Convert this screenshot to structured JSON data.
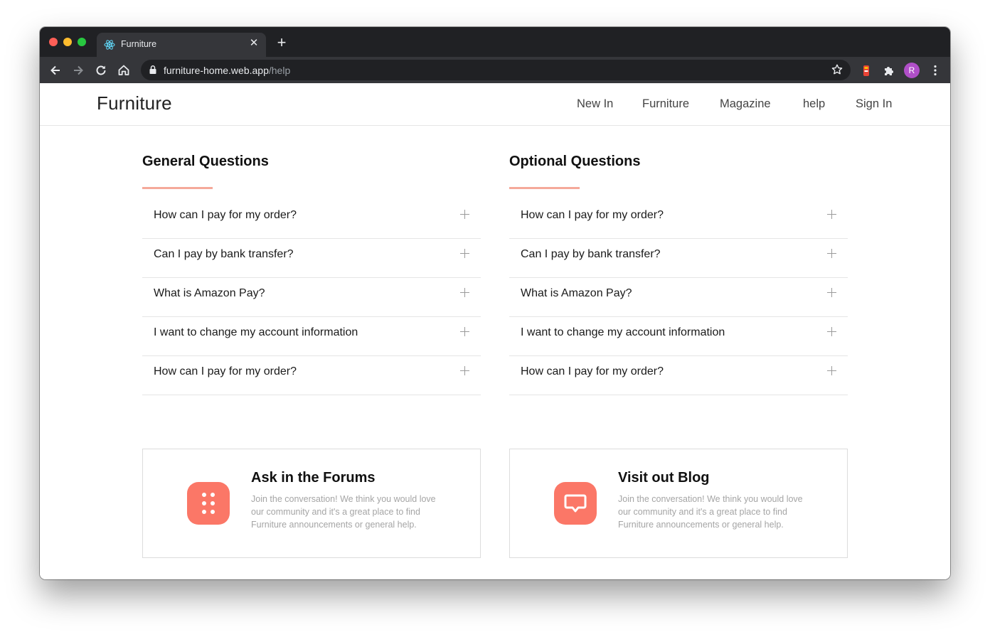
{
  "browser": {
    "tab_title": "Furniture",
    "url_host": "furniture-home.web.app",
    "url_path": "/help",
    "profile_initial": "R",
    "icons": [
      "back-icon",
      "forward-icon",
      "reload-icon",
      "home-icon",
      "lock-icon",
      "star-icon",
      "extension-icon",
      "puzzle-icon",
      "menu-dots-icon"
    ]
  },
  "site": {
    "logo": "Furniture",
    "nav": [
      "New In",
      "Furniture",
      "Magazine",
      "help",
      "Sign In"
    ]
  },
  "faq": [
    {
      "heading": "General Questions",
      "items": [
        "How can I pay for my order?",
        "Can I pay by bank transfer?",
        "What is Amazon Pay?",
        "I want to change my account information",
        "How can I pay for my order?"
      ]
    },
    {
      "heading": "Optional Questions",
      "items": [
        "How can I pay for my order?",
        "Can I pay by bank transfer?",
        "What is Amazon Pay?",
        "I want to change my account information",
        "How can I pay for my order?"
      ]
    }
  ],
  "cards": [
    {
      "title": "Ask in the Forums",
      "text": "Join the conversation! We think you would love our community and it's a great place to find Furniture announcements or general help.",
      "icon": "dots-grid-icon"
    },
    {
      "title": "Visit out Blog",
      "text": "Join the conversation! We think you would love our community and it's a great place to find Furniture announcements or general help.",
      "icon": "chat-bubble-icon"
    }
  ],
  "colors": {
    "accent": "#fb7767",
    "underline": "#f5a99a",
    "chrome_dark": "#202124",
    "chrome_toolbar": "#35363a"
  }
}
